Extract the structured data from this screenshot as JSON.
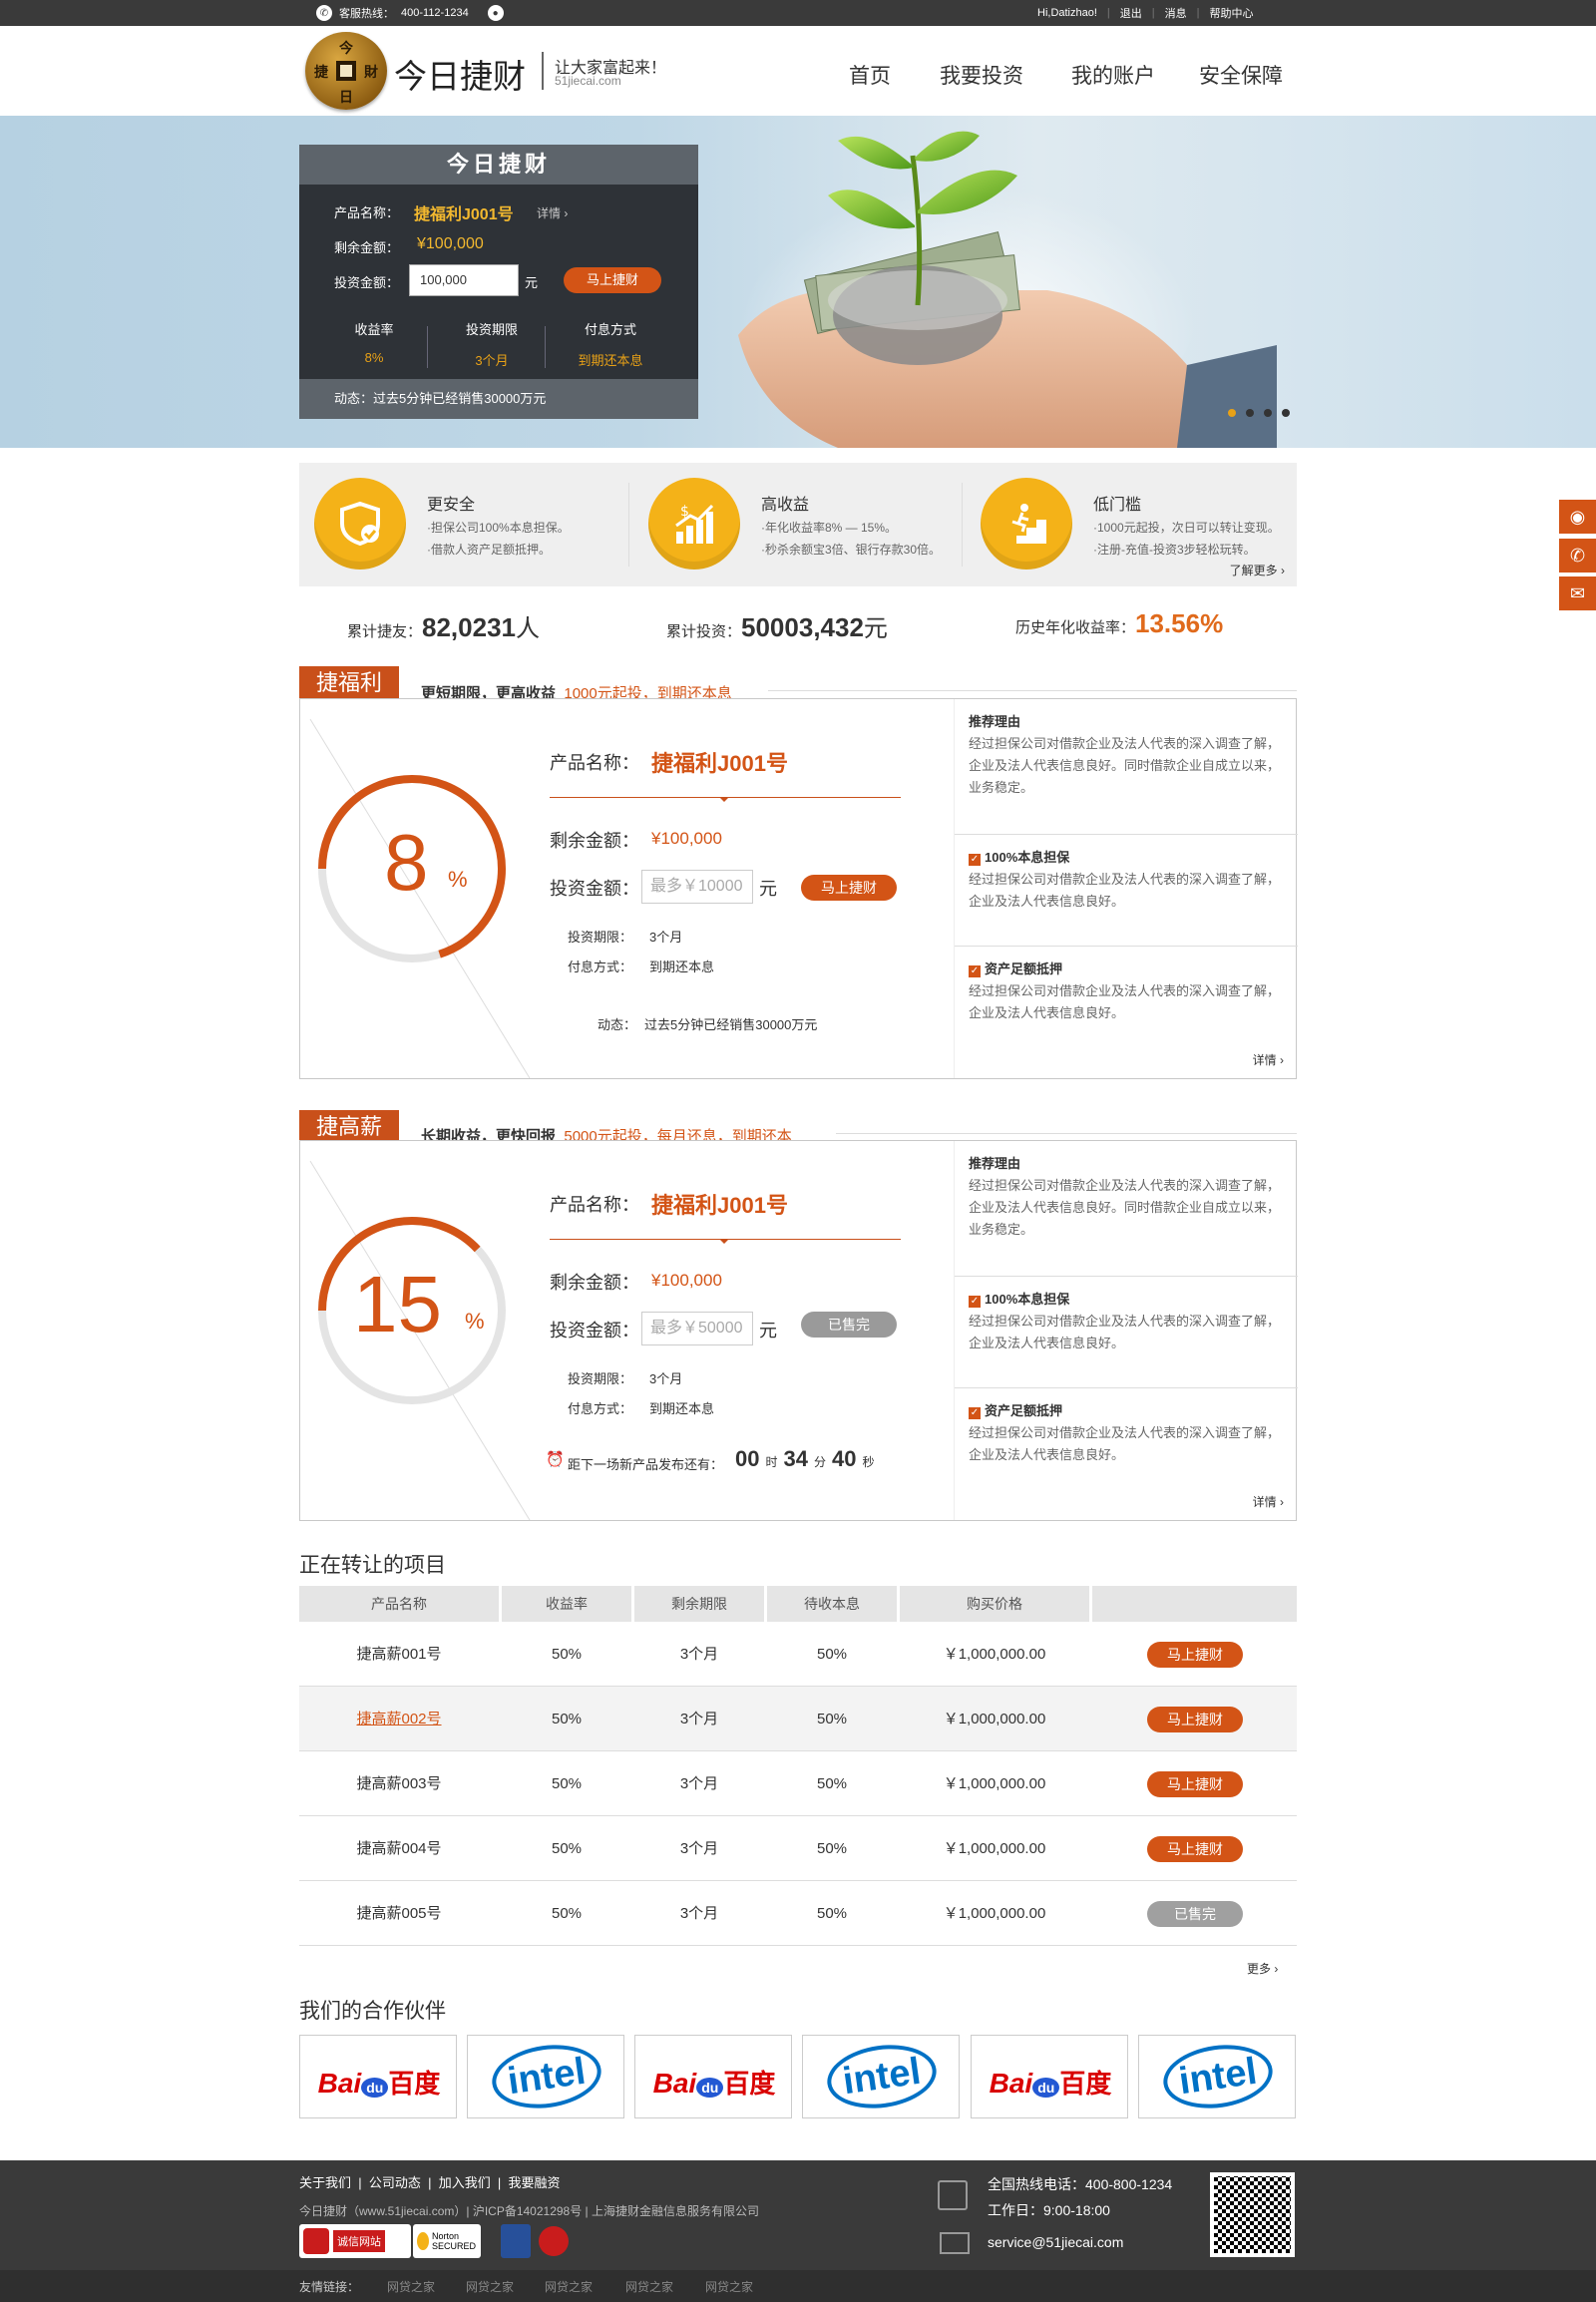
{
  "topbar": {
    "hotline_label": "客服热线：",
    "hotline": "400-112-1234",
    "greeting": "Hi,Datizhao!",
    "logout": "退出",
    "messages": "消息",
    "help": "帮助中心"
  },
  "header": {
    "logo_name": "今日捷财",
    "slogan": "让大家富起来！",
    "site": "51jiecai.com",
    "coin_chars": [
      "今",
      "捷",
      "財",
      "日"
    ]
  },
  "nav": [
    "首页",
    "我要投资",
    "我的账户",
    "安全保障"
  ],
  "banner": {
    "card_title": "今日捷财",
    "name_label": "产品名称：",
    "name": "捷福利J001号",
    "detail": "详情",
    "remain_label": "剩余金额：",
    "remain": "¥100,000",
    "invest_label": "投资金额：",
    "invest_value": "100,000",
    "unit": "元",
    "button": "马上捷财",
    "cols": [
      {
        "label": "收益率",
        "value": "8%"
      },
      {
        "label": "投资期限",
        "value": "3个月"
      },
      {
        "label": "付息方式",
        "value": "到期还本息"
      }
    ],
    "news": "动态：过去5分钟已经销售30000万元",
    "dots_active": 0
  },
  "features": {
    "items": [
      {
        "title": "更安全",
        "lines": [
          "·担保公司100%本息担保。",
          "·借款人资产足额抵押。"
        ],
        "icon": "shield-check-icon"
      },
      {
        "title": "高收益",
        "lines": [
          "·年化收益率8% — 15%。",
          "·秒杀余额宝3倍、银行存款30倍。"
        ],
        "icon": "growth-chart-icon"
      },
      {
        "title": "低门槛",
        "lines": [
          "·1000元起投，次日可以转让变现。",
          "·注册-充值-投资3步轻松玩转。"
        ],
        "icon": "stairs-runner-icon"
      }
    ],
    "more": "了解更多"
  },
  "stats": [
    {
      "label": "累计捷友：",
      "value": "82,0231",
      "unit": "人"
    },
    {
      "label": "累计投资：",
      "value": "50003,432",
      "unit": "元"
    },
    {
      "label": "历史年化收益率：",
      "value": "13.56%",
      "unit": ""
    }
  ],
  "products": [
    {
      "tag": "捷福利",
      "sub_bold": "更短期限，更高收益",
      "sub_orange": "1000元起投，到期还本息",
      "rate": "8",
      "rate_unit": "%",
      "rate_fraction": 0.7,
      "name_label": "产品名称：",
      "name": "捷福利J001号",
      "remain_label": "剩余金额：",
      "remain": "¥100,000",
      "invest_label": "投资金额：",
      "invest_placeholder": "最多￥10000",
      "unit": "元",
      "button": "马上捷财",
      "period_label": "投资期限：",
      "period": "3个月",
      "pay_label": "付息方式：",
      "pay": "到期还本息",
      "news_label": "动态：",
      "news": "过去5分钟已经销售30000万元",
      "reasons": [
        {
          "title": "推荐理由",
          "text": "经过担保公司对借款企业及法人代表的深入调查了解，企业及法人代表信息良好。同时借款企业自成立以来，业务稳定。"
        },
        {
          "title": "100%本息担保",
          "text": "经过担保公司对借款企业及法人代表的深入调查了解，企业及法人代表信息良好。"
        },
        {
          "title": "资产足额抵押",
          "text": "经过担保公司对借款企业及法人代表的深入调查了解，企业及法人代表信息良好。"
        }
      ],
      "detail": "详情"
    },
    {
      "tag": "捷高薪",
      "sub_bold": "长期收益，更快回报",
      "sub_orange": "5000元起投，每月还息，到期还本",
      "rate": "15",
      "rate_unit": "%",
      "rate_fraction": 0.38,
      "name_label": "产品名称：",
      "name": "捷福利J001号",
      "remain_label": "剩余金额：",
      "remain": "¥100,000",
      "invest_label": "投资金额：",
      "invest_placeholder": "最多￥50000",
      "unit": "元",
      "button": "已售完",
      "period_label": "投资期限：",
      "period": "3个月",
      "pay_label": "付息方式：",
      "pay": "到期还本息",
      "countdown_label": "距下一场新产品发布还有：",
      "h": "00",
      "h_unit": "时",
      "m": "34",
      "m_unit": "分",
      "s": "40",
      "s_unit": "秒",
      "reasons": [
        {
          "title": "推荐理由",
          "text": "经过担保公司对借款企业及法人代表的深入调查了解，企业及法人代表信息良好。同时借款企业自成立以来，业务稳定。"
        },
        {
          "title": "100%本息担保",
          "text": "经过担保公司对借款企业及法人代表的深入调查了解，企业及法人代表信息良好。"
        },
        {
          "title": "资产足额抵押",
          "text": "经过担保公司对借款企业及法人代表的深入调查了解，企业及法人代表信息良好。"
        }
      ],
      "detail": "详情"
    }
  ],
  "transfer": {
    "title": "正在转让的项目",
    "headers": [
      "产品名称",
      "收益率",
      "剩余期限",
      "待收本息",
      "购买价格",
      ""
    ],
    "rows": [
      {
        "name": "捷高薪001号",
        "rate": "50%",
        "term": "3个月",
        "due": "50%",
        "price": "￥1,000,000.00",
        "btn": "马上捷财",
        "sold": false
      },
      {
        "name": "捷高薪002号",
        "rate": "50%",
        "term": "3个月",
        "due": "50%",
        "price": "￥1,000,000.00",
        "btn": "马上捷财",
        "sold": false
      },
      {
        "name": "捷高薪003号",
        "rate": "50%",
        "term": "3个月",
        "due": "50%",
        "price": "￥1,000,000.00",
        "btn": "马上捷财",
        "sold": false
      },
      {
        "name": "捷高薪004号",
        "rate": "50%",
        "term": "3个月",
        "due": "50%",
        "price": "￥1,000,000.00",
        "btn": "马上捷财",
        "sold": false
      },
      {
        "name": "捷高薪005号",
        "rate": "50%",
        "term": "3个月",
        "due": "50%",
        "price": "￥1,000,000.00",
        "btn": "已售完",
        "sold": true
      }
    ],
    "more": "更多"
  },
  "partners": {
    "title": "我们的合作伙伴",
    "items": [
      "baidu",
      "intel",
      "baidu",
      "intel",
      "baidu",
      "intel"
    ],
    "baidu_text": "Bai",
    "baidu_du": "du",
    "baidu_cn": "百度",
    "intel_text": "intel"
  },
  "footer": {
    "links": [
      "关于我们",
      "公司动态",
      "加入我们",
      "我要融资"
    ],
    "icp": "今日捷财（www.51jiecai.com）| 沪ICP备14021298号 | 上海捷财金融信息服务有限公司",
    "hotline": "全国热线电话：400-800-1234",
    "hours": "工作日：9:00-18:00",
    "email": "service@51jiecai.com",
    "friend_label": "友情链接：",
    "friends": [
      "网贷之家",
      "网贷之家",
      "网贷之家",
      "网贷之家",
      "网贷之家"
    ],
    "badges": [
      "诚信网站",
      "Norton SECURED"
    ]
  },
  "colors": {
    "accent": "#d35416",
    "gold": "#f4b218",
    "dark": "#3a3a3a"
  }
}
